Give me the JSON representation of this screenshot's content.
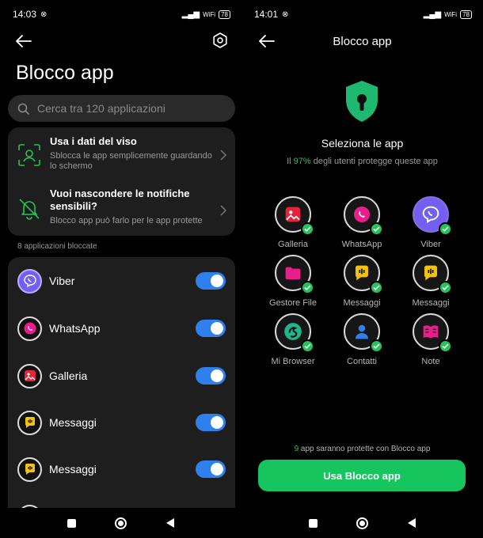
{
  "left": {
    "status": {
      "time": "14:03",
      "network": "WiFi",
      "battery": "78"
    },
    "title": "Blocco app",
    "search": {
      "placeholder": "Cerca tra 120 applicazioni",
      "value": ""
    },
    "features": [
      {
        "title": "Usa i dati del viso",
        "desc": "Sblocca le app semplicemente guardando lo schermo",
        "icon": "face-scan-icon"
      },
      {
        "title": "Vuoi nascondere le notifiche sensibili?",
        "desc": "Blocco app può farlo per le app protette",
        "icon": "bell-off-icon"
      }
    ],
    "section_label": "8 applicazioni bloccate",
    "apps": [
      {
        "name": "Viber",
        "icon": "viber-icon",
        "color": "#7360f2",
        "enabled": true
      },
      {
        "name": "WhatsApp",
        "icon": "whatsapp-icon",
        "color": "#e91e8c",
        "enabled": true
      },
      {
        "name": "Galleria",
        "icon": "gallery-icon",
        "color": "#e5243b",
        "enabled": true
      },
      {
        "name": "Messaggi",
        "icon": "messages-icon",
        "color": "#f4c20d",
        "enabled": true
      },
      {
        "name": "Messaggi",
        "icon": "messages-icon",
        "color": "#f4c20d",
        "enabled": true
      }
    ]
  },
  "right": {
    "status": {
      "time": "14:01",
      "network": "WiFi",
      "battery": "78"
    },
    "title": "Blocco app",
    "heading": "Seleziona le app",
    "subtitle_pre": "Il ",
    "subtitle_pct": "97%",
    "subtitle_post": " degli utenti protegge queste app",
    "apps": [
      {
        "name": "Galleria",
        "icon": "gallery-icon",
        "color": "#e5243b"
      },
      {
        "name": "WhatsApp",
        "icon": "whatsapp-icon",
        "color": "#e91e8c"
      },
      {
        "name": "Viber",
        "icon": "viber-icon",
        "color": "#7360f2"
      },
      {
        "name": "Gestore File",
        "icon": "folder-icon",
        "color": "#e91e8c"
      },
      {
        "name": "Messaggi",
        "icon": "messages-icon",
        "color": "#f4c20d"
      },
      {
        "name": "Messaggi",
        "icon": "messages-icon",
        "color": "#f4c20d"
      },
      {
        "name": "Mi Browser",
        "icon": "browser-icon",
        "color": "#1fb58c"
      },
      {
        "name": "Contatti",
        "icon": "contacts-icon",
        "color": "#2f80ed"
      },
      {
        "name": "Note",
        "icon": "notes-icon",
        "color": "#e91e8c"
      }
    ],
    "note_num": "9",
    "note_text": " app saranno protette con Blocco app",
    "cta": "Usa Blocco app"
  },
  "colors": {
    "accent_blue": "#2f80ed",
    "accent_green": "#17c55e",
    "card": "#1e1e1e"
  }
}
